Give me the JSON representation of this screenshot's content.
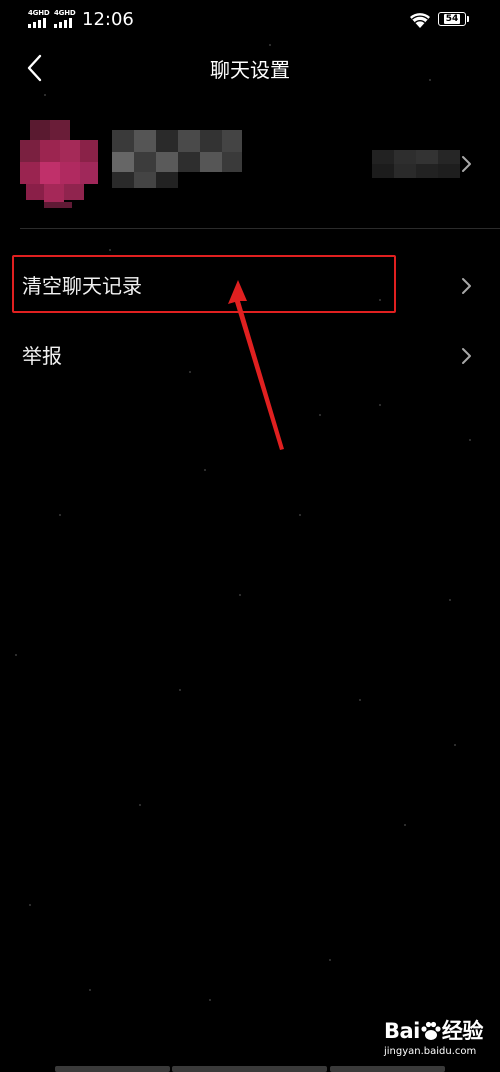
{
  "status_bar": {
    "network_1": "4GHD",
    "network_2": "4GHD",
    "time": "12:06",
    "battery_level": "54"
  },
  "header": {
    "title": "聊天设置",
    "back_icon": "chevron-left-icon"
  },
  "profile": {
    "avatar_color": "#b0285c",
    "chevron_icon": "chevron-right-icon"
  },
  "menu": {
    "items": [
      {
        "label": "清空聊天记录",
        "icon": "chevron-right-icon",
        "highlighted": true
      },
      {
        "label": "举报",
        "icon": "chevron-right-icon",
        "highlighted": false
      }
    ]
  },
  "annotation": {
    "color": "#e02020"
  },
  "watermark": {
    "brand_left": "Bai",
    "brand_right": "经验",
    "url": "jingyan.baidu.com"
  }
}
